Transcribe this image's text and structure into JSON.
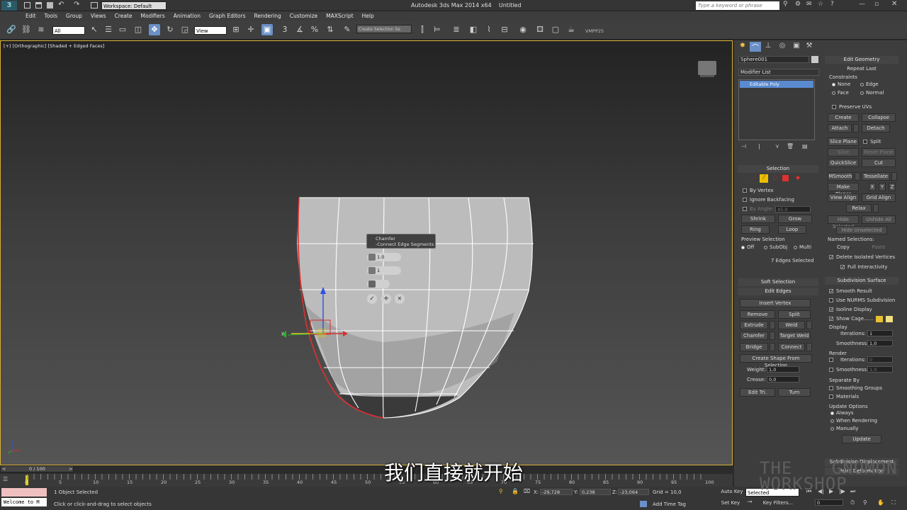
{
  "titlebar": {
    "workspace": "Workspace: Default",
    "app_title": "Autodesk 3ds Max 2014 x64",
    "doc_title": "Untitled",
    "search_placeholder": "Type a keyword or phrase"
  },
  "menu": [
    "Edit",
    "Tools",
    "Group",
    "Views",
    "Create",
    "Modifiers",
    "Animation",
    "Graph Editors",
    "Rendering",
    "Customize",
    "MAXScript",
    "Help"
  ],
  "toolbar": {
    "filter_value": "All",
    "ref_coord_value": "View",
    "selection_set_value": "Create Selection Se",
    "vmpp_label": "VMPP25"
  },
  "viewport": {
    "label": "[+] [Orthographic] [Shaded + Edged Faces]",
    "caddy_title": "Chamfer",
    "caddy_subtitle": "-Connect Edge Segments",
    "caddy_amount": "1.0",
    "caddy_segments": "1",
    "gizmo_z": "z",
    "gizmo_y": "y"
  },
  "command_panel": {
    "object_name": "Sphere001",
    "modifier_list": "Modifier List",
    "stack_item": "Editable Poly",
    "selection": {
      "header": "Selection",
      "by_vertex": "By Vertex",
      "ignore_backfacing": "Ignore Backfacing",
      "by_angle": "By Angle:",
      "angle_value": "45.0",
      "shrink": "Shrink",
      "grow": "Grow",
      "ring": "Ring",
      "loop": "Loop",
      "preview_selection": "Preview Selection",
      "off": "Off",
      "subobj": "SubObj",
      "multi": "Multi",
      "status": "7 Edges Selected"
    },
    "soft_selection": "Soft Selection",
    "edit_edges": {
      "header": "Edit Edges",
      "insert_vertex": "Insert Vertex",
      "remove": "Remove",
      "split": "Split",
      "extrude": "Extrude",
      "weld": "Weld",
      "chamfer": "Chamfer",
      "target_weld": "Target Weld",
      "bridge": "Bridge",
      "connect": "Connect",
      "create_shape": "Create Shape From Selection",
      "weight_label": "Weight:",
      "weight_value": "1,0",
      "crease_label": "Crease:",
      "crease_value": "0,0",
      "edit_tri": "Edit Tri.",
      "turn": "Turn"
    },
    "edit_geometry": {
      "header": "Edit Geometry",
      "repeat_last": "Repeat Last",
      "constraints": "Constraints",
      "none": "None",
      "edge": "Edge",
      "face": "Face",
      "normal": "Normal",
      "preserve_uvs": "Preserve UVs",
      "create": "Create",
      "collapse": "Collapse",
      "attach": "Attach",
      "detach": "Detach",
      "slice_plane": "Slice Plane",
      "split": "Split",
      "slice": "Slice",
      "reset_plane": "Reset Plane",
      "quickslice": "QuickSlice",
      "cut": "Cut",
      "msmooth": "MSmooth",
      "tessellate": "Tessellate",
      "make_planar": "Make Planar",
      "x": "X",
      "y": "Y",
      "z": "Z",
      "view_align": "View Align",
      "grid_align": "Grid Align",
      "relax": "Relax",
      "hide_selected": "Hide Selected",
      "unhide_all": "Unhide All",
      "hide_unselected": "Hide Unselected",
      "named_selections": "Named Selections:",
      "copy": "Copy",
      "paste": "Paste",
      "delete_isolated": "Delete Isolated Vertices",
      "full_interactivity": "Full Interactivity"
    },
    "subdivision_surface": {
      "header": "Subdivision Surface",
      "smooth_result": "Smooth Result",
      "use_nurms": "Use NURMS Subdivision",
      "isoline_display": "Isoline Display",
      "show_cage": "Show Cage......",
      "display": "Display",
      "iterations_label": "Iterations:",
      "display_iterations": "1",
      "smoothness_label": "Smoothness:",
      "display_smoothness": "1,0",
      "render": "Render",
      "render_iterations": "0",
      "render_smoothness": "1,0",
      "separate_by": "Separate By",
      "smoothing_groups": "Smoothing Groups",
      "materials": "Materials",
      "update_options": "Update Options",
      "always": "Always",
      "when_rendering": "When Rendering",
      "manually": "Manually",
      "update": "Update"
    },
    "subdivision_displacement": "Subdivision Displacement",
    "paint_deformation": "Paint Deformation"
  },
  "timeline": {
    "frame_counter": "0 / 100",
    "ticks": [
      "0",
      "5",
      "10",
      "15",
      "20",
      "25",
      "30",
      "35",
      "40",
      "45",
      "50",
      "55",
      "60",
      "65",
      "70",
      "75",
      "80",
      "85",
      "90",
      "95",
      "100"
    ]
  },
  "status": {
    "maxscript": "Welcome to M",
    "selected": "1 Object Selected",
    "prompt": "Click or click-and-drag to select objects",
    "x_label": "X:",
    "x_value": "-29,728",
    "y_label": "Y:",
    "y_value": "0,238",
    "z_label": "Z:",
    "z_value": "-23,064",
    "grid": "Grid = 10,0",
    "add_time_tag": "Add Time Tag",
    "auto_key": "Auto Key",
    "set_key": "Set Key",
    "key_mode": "Selected",
    "key_filters": "Key Filters...",
    "current_frame": "0"
  },
  "overlay": {
    "subtitle": "我们直接就开始",
    "watermark": "THE GNOMON WORKSHOP"
  },
  "colors": {
    "accent_blue": "#6a90c7",
    "viewport_border": "#d8b035",
    "selected_edge": "#e03030"
  }
}
